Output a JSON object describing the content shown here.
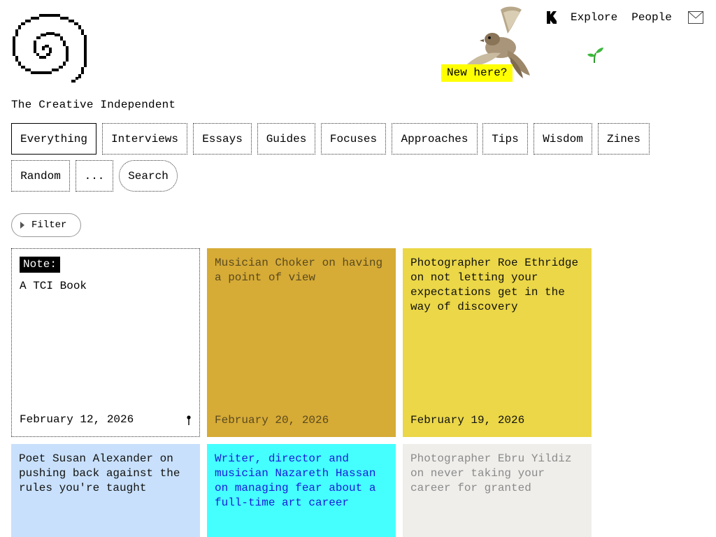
{
  "site": {
    "title": "The Creative Independent",
    "new_here": "New here?"
  },
  "top_nav": {
    "items": [
      "Explore",
      "People"
    ],
    "icons": [
      "kickstarter-icon",
      "mail-icon",
      "sprout-icon"
    ]
  },
  "tabs": {
    "items": [
      {
        "label": "Everything",
        "active": true
      },
      {
        "label": "Interviews"
      },
      {
        "label": "Essays"
      },
      {
        "label": "Guides"
      },
      {
        "label": "Focuses"
      },
      {
        "label": "Approaches"
      },
      {
        "label": "Tips"
      },
      {
        "label": "Wisdom"
      },
      {
        "label": "Zines"
      },
      {
        "label": "Random"
      },
      {
        "label": "..."
      },
      {
        "label": "Search"
      }
    ]
  },
  "filter": {
    "label": "Filter"
  },
  "cards": [
    {
      "tag": "Note:",
      "title": "A TCI Book",
      "date": "February 12, 2026",
      "color": "#ffffff"
    },
    {
      "title": "Musician Choker on having a point of view",
      "date": "February 20, 2026",
      "color": "#d6ab36"
    },
    {
      "title": "Photographer Roe Ethridge on not letting your expectations get in the way of discovery",
      "date": "February 19, 2026",
      "color": "#ebd747"
    },
    {
      "title": "Poet Susan Alexander on pushing back against the rules you're taught",
      "color": "#c8e0fb"
    },
    {
      "title": "Writer, director and musician Nazareth Hassan on managing fear about a full-time art career",
      "color": "#45ffff"
    },
    {
      "title": "Photographer Ebru Yildiz on never taking your career for granted",
      "color": "#efeeeb"
    }
  ]
}
